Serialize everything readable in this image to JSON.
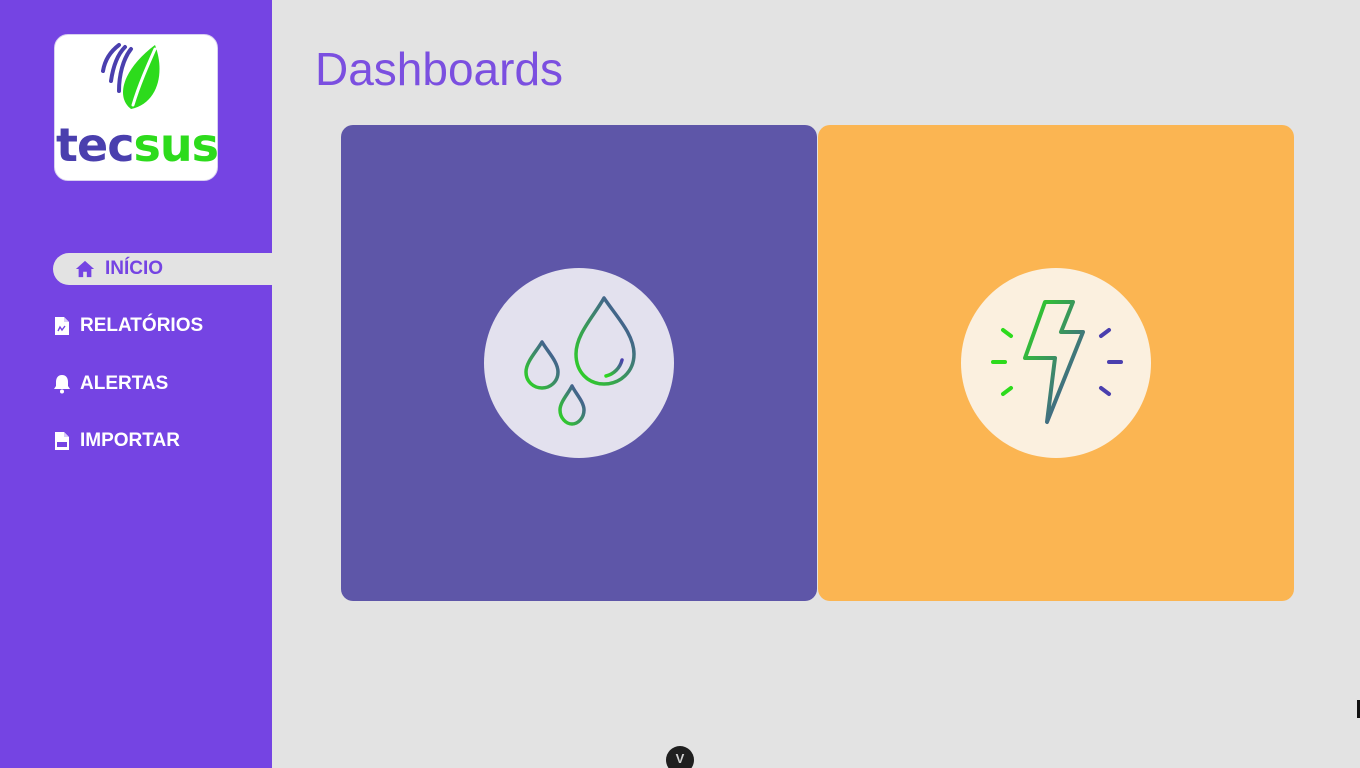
{
  "brand": {
    "logo_text_left": "tec",
    "logo_text_right": "sus"
  },
  "sidebar": {
    "items": [
      {
        "label": "INÍCIO",
        "icon": "home-icon",
        "active": true
      },
      {
        "label": "RELATÓRIOS",
        "icon": "report-file-icon",
        "active": false
      },
      {
        "label": "ALERTAS",
        "icon": "bell-icon",
        "active": false
      },
      {
        "label": "IMPORTAR",
        "icon": "csv-file-icon",
        "active": false
      }
    ]
  },
  "main": {
    "title": "Dashboards",
    "cards": [
      {
        "name": "water",
        "icon": "water-drops-icon",
        "color": "#5e56a8"
      },
      {
        "name": "energy",
        "icon": "lightning-bolt-icon",
        "color": "#fbb552"
      }
    ]
  },
  "bottom_handle": {
    "glyph": "V"
  },
  "colors": {
    "sidebar": "#7544e3",
    "accent": "#7b4fe0",
    "background": "#e3e3e3"
  }
}
